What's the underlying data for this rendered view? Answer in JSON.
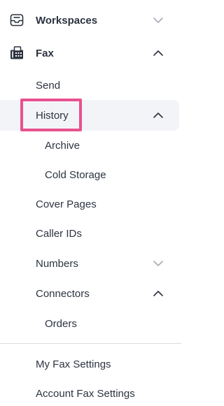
{
  "nav": {
    "workspaces": {
      "label": "Workspaces",
      "icon": "inbox-tray-icon",
      "chevron": "chevron-down-icon"
    },
    "fax": {
      "label": "Fax",
      "icon": "fax-machine-icon",
      "chevron": "chevron-up-icon"
    },
    "send": {
      "label": "Send"
    },
    "history": {
      "label": "History",
      "chevron": "chevron-up-icon"
    },
    "archive": {
      "label": "Archive"
    },
    "cold_storage": {
      "label": "Cold Storage"
    },
    "cover_pages": {
      "label": "Cover Pages"
    },
    "caller_ids": {
      "label": "Caller IDs"
    },
    "numbers": {
      "label": "Numbers",
      "chevron": "chevron-down-icon"
    },
    "connectors": {
      "label": "Connectors",
      "chevron": "chevron-up-icon"
    },
    "orders": {
      "label": "Orders"
    },
    "my_fax_settings": {
      "label": "My Fax Settings"
    },
    "account_fax_settings": {
      "label": "Account Fax Settings"
    }
  },
  "colors": {
    "highlight": "#e8518f",
    "active_row_bg": "#f3f4f7",
    "text": "#2c3340",
    "chevron": "#2c3340",
    "chevron_muted": "#a7acb6"
  }
}
